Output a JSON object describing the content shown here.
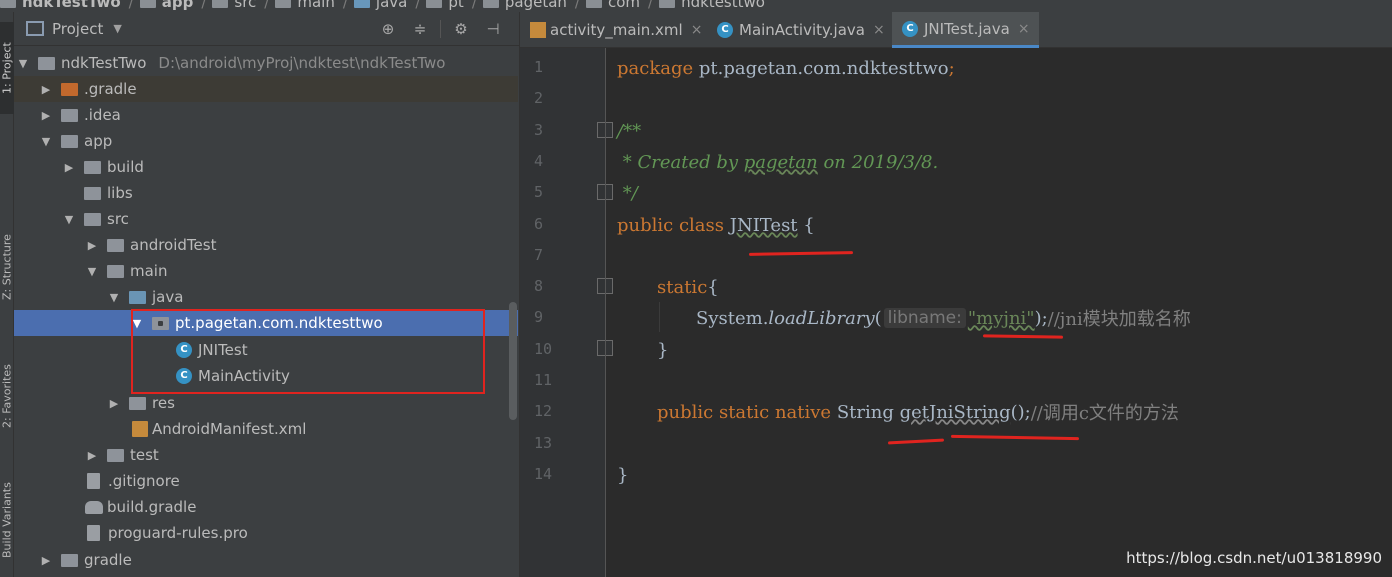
{
  "breadcrumb": [
    "ndkTestTwo",
    "app",
    "src",
    "main",
    "java",
    "pt",
    "pagetan",
    "com",
    "ndktesttwo"
  ],
  "left_strip": {
    "project_tab": "1: Project",
    "structure_tab": "Z: Structure",
    "favorites_tab": "2: Favorites",
    "build_variants_tab": "Build Variants"
  },
  "project_panel": {
    "title": "Project",
    "tree": [
      {
        "label": "ndkTestTwo",
        "path": "D:\\android\\myProj\\ndktest\\ndkTestTwo"
      },
      {
        "label": ".gradle"
      },
      {
        "label": ".idea"
      },
      {
        "label": "app"
      },
      {
        "label": "build"
      },
      {
        "label": "libs"
      },
      {
        "label": "src"
      },
      {
        "label": "androidTest"
      },
      {
        "label": "main"
      },
      {
        "label": "java"
      },
      {
        "label": "pt.pagetan.com.ndktesttwo"
      },
      {
        "label": "JNITest"
      },
      {
        "label": "MainActivity"
      },
      {
        "label": "res"
      },
      {
        "label": "AndroidManifest.xml"
      },
      {
        "label": "test"
      },
      {
        "label": ".gitignore"
      },
      {
        "label": "build.gradle"
      },
      {
        "label": "proguard-rules.pro"
      },
      {
        "label": "gradle"
      }
    ]
  },
  "editor": {
    "tabs": [
      {
        "label": "activity_main.xml"
      },
      {
        "label": "MainActivity.java"
      },
      {
        "label": "JNITest.java"
      }
    ],
    "line_numbers": [
      "1",
      "2",
      "3",
      "4",
      "5",
      "6",
      "7",
      "8",
      "9",
      "10",
      "11",
      "12",
      "13",
      "14"
    ],
    "code": {
      "l1_kw": "package",
      "l1_rest": " pt.pagetan.com.ndktesttwo",
      "l1_semi": ";",
      "l3": "/**",
      "l4_a": " * Created by ",
      "l4_user": "pagetan",
      "l4_b": " on 2019/3/8.",
      "l5": " */",
      "l6_kw": "public class ",
      "l6_name": "JNITest",
      "l6_brace": " {",
      "l8_kw": "static",
      "l8_brace": "{",
      "l9_obj": "System.",
      "l9_method": "loadLibrary",
      "l9_paren": "(",
      "l9_hint": "libname:",
      "l9_str": "\"myjni\"",
      "l9_close": ");",
      "l9_comment": "//jni模块加载名称",
      "l10": "}",
      "l12_kw": "public static native ",
      "l12_type": "String ",
      "l12_method": "getJniString",
      "l12_paren": "();",
      "l12_comment": "//调用c文件的方法",
      "l14": "}"
    }
  },
  "watermark": "https://blog.csdn.net/u013818990"
}
